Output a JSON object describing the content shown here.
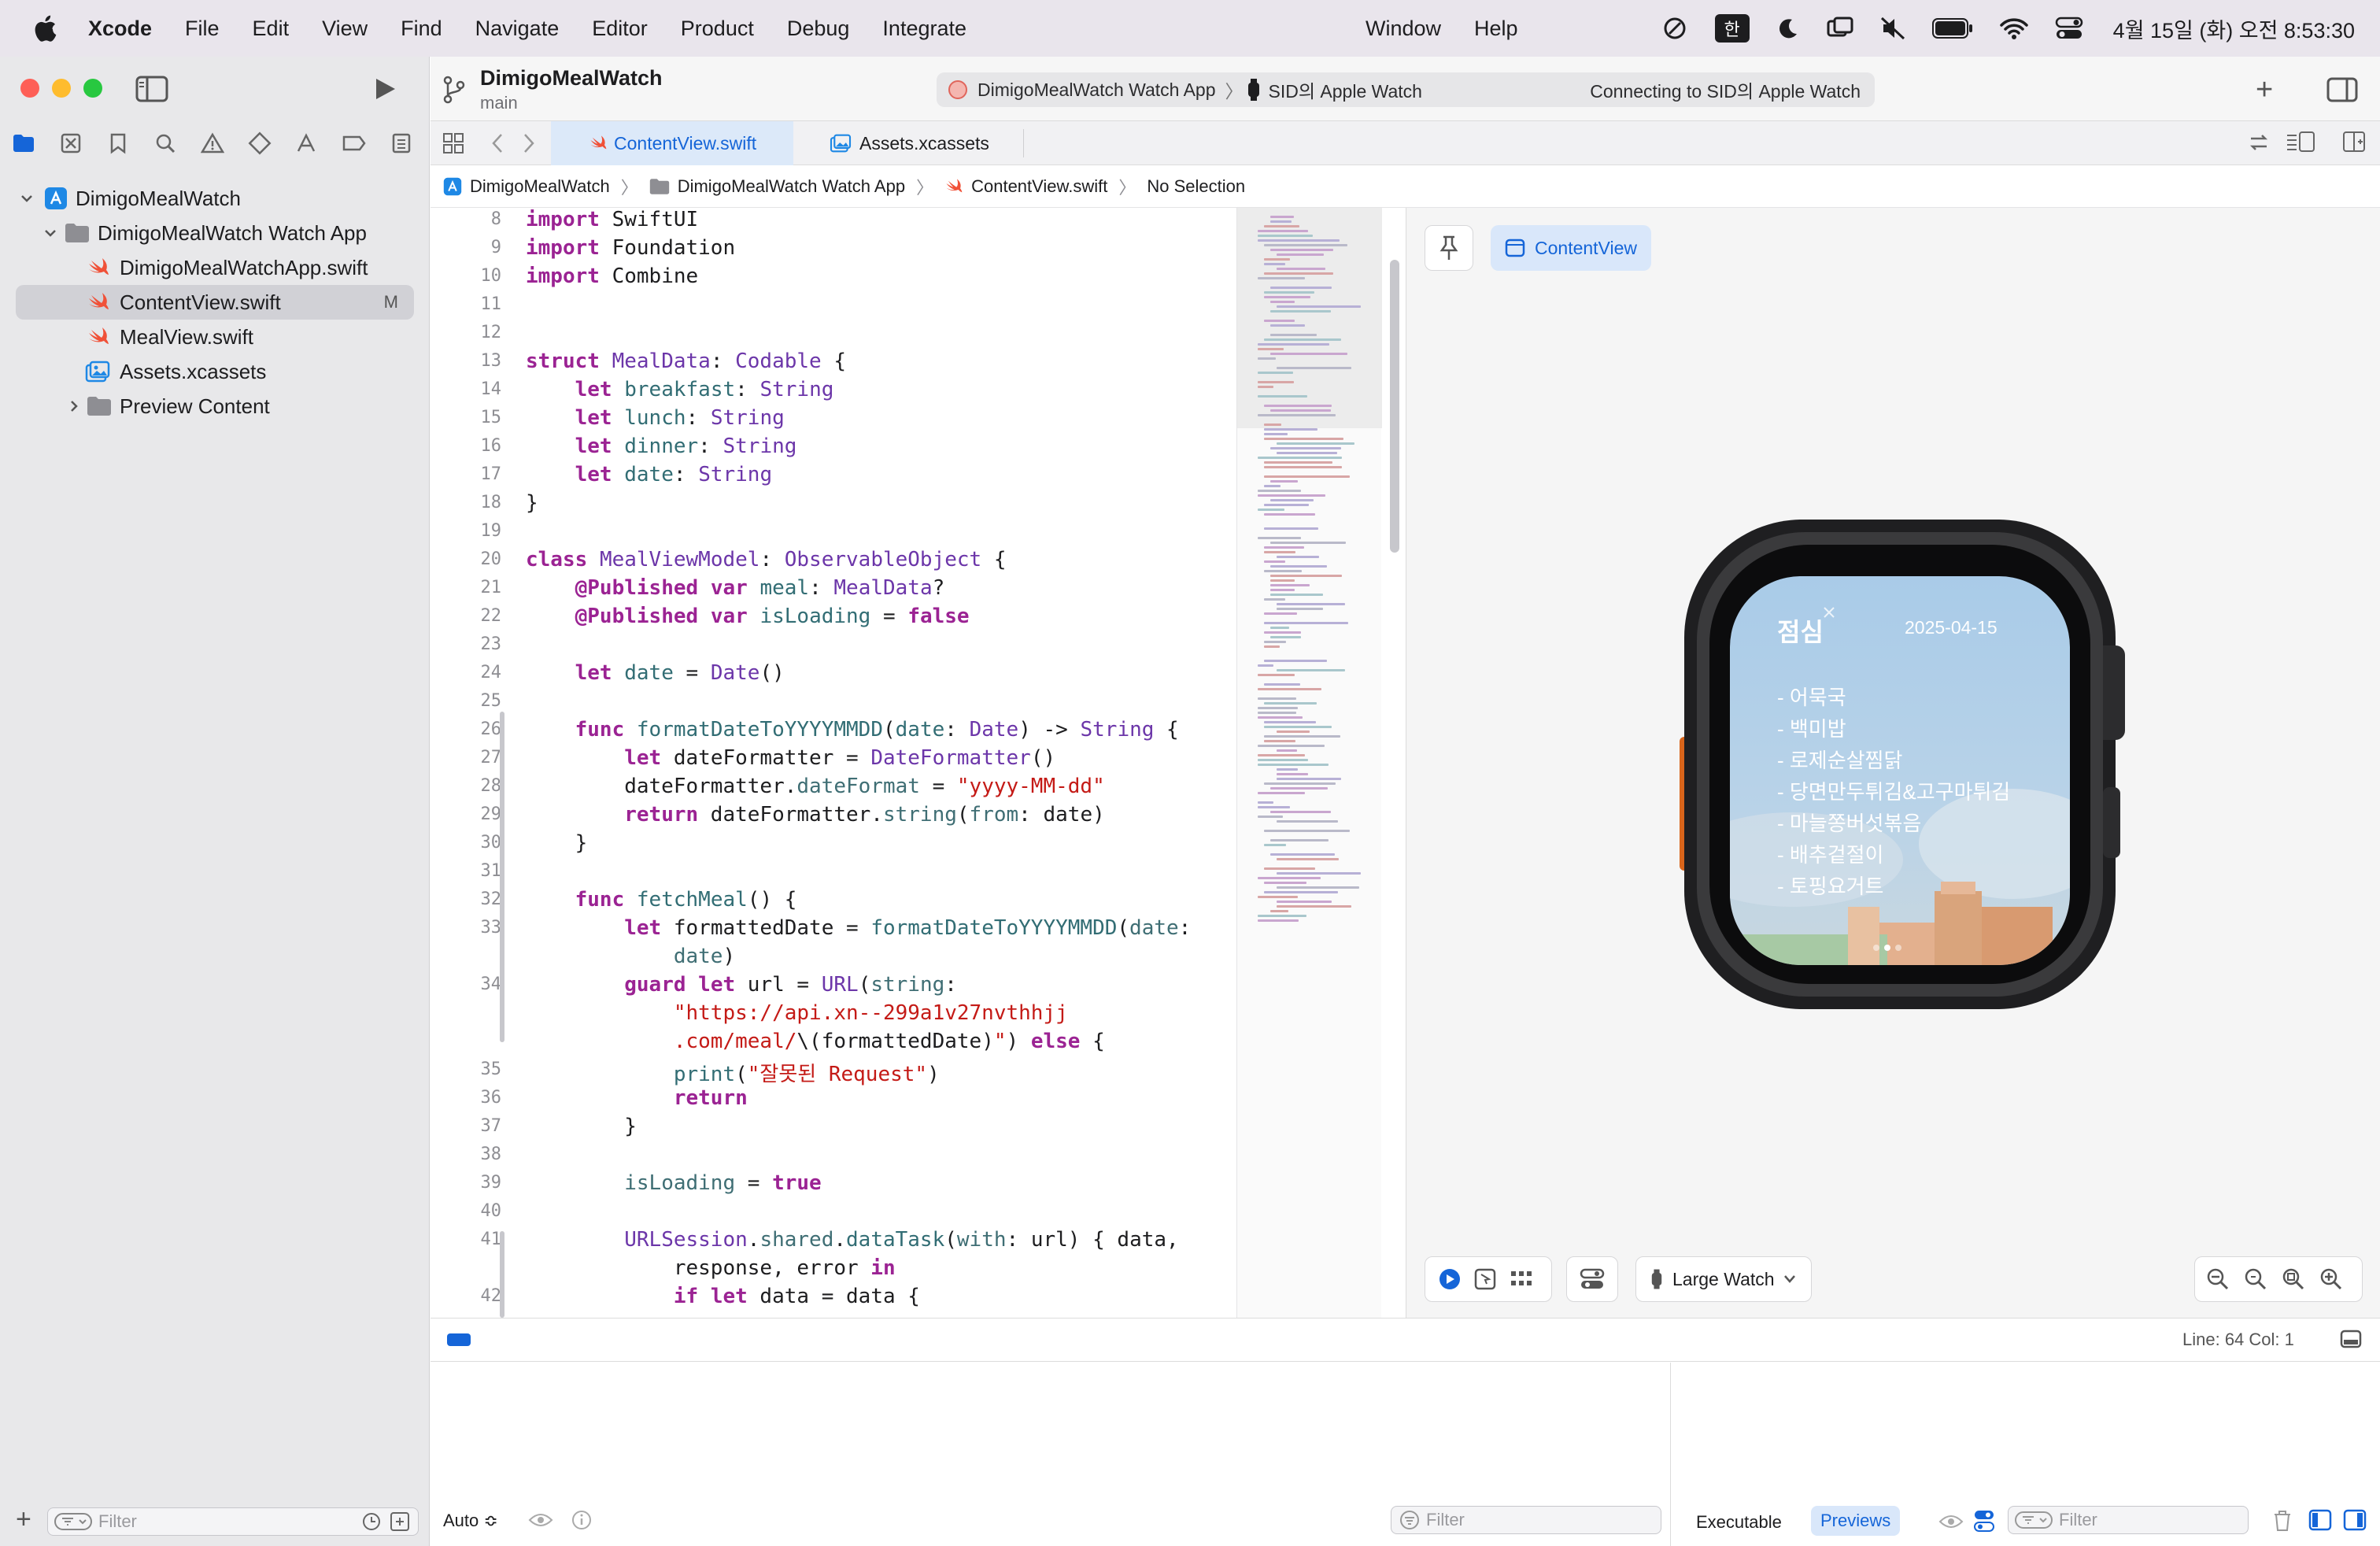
{
  "menubar": {
    "app_name": "Xcode",
    "menus": [
      "File",
      "Edit",
      "View",
      "Find",
      "Navigate",
      "Editor",
      "Product",
      "Debug",
      "Integrate"
    ],
    "right_menus": [
      "Window",
      "Help"
    ],
    "ime_label": "한",
    "clock": "4월 15일 (화) 오전 8:53:30"
  },
  "toolbar": {
    "project_title": "DimigoMealWatch",
    "branch": "main",
    "scheme_target": "DimigoMealWatch Watch App",
    "scheme_device": "SID의 Apple Watch",
    "status": "Connecting to SID의 Apple Watch",
    "add_label": "+"
  },
  "navigator": {
    "items": [
      {
        "label": "DimigoMealWatch",
        "badge": ""
      },
      {
        "label": "DimigoMealWatch Watch App",
        "badge": ""
      },
      {
        "label": "DimigoMealWatchApp.swift",
        "badge": ""
      },
      {
        "label": "ContentView.swift",
        "badge": "M"
      },
      {
        "label": "MealView.swift",
        "badge": ""
      },
      {
        "label": "Assets.xcassets",
        "badge": ""
      },
      {
        "label": "Preview Content",
        "badge": ""
      }
    ],
    "filter_placeholder": "Filter",
    "add_label": "+"
  },
  "tabs": [
    {
      "label": "ContentView.swift",
      "active": true
    },
    {
      "label": "Assets.xcassets",
      "active": false
    }
  ],
  "jumpbar": [
    "DimigoMealWatch",
    "DimigoMealWatch Watch App",
    "ContentView.swift",
    "No Selection"
  ],
  "code": {
    "line_numbers": [
      "8",
      "9",
      "10",
      "11",
      "12",
      "13",
      "14",
      "15",
      "16",
      "17",
      "18",
      "19",
      "20",
      "21",
      "22",
      "23",
      "24",
      "25",
      "26",
      "27",
      "28",
      "29",
      "30",
      "31",
      "32",
      "33",
      "",
      "34",
      "",
      "",
      "35",
      "36",
      "37",
      "38",
      "39",
      "40",
      "41",
      "",
      "42"
    ]
  },
  "canvas": {
    "preview_label": "ContentView",
    "device_label": "Large Watch"
  },
  "watch": {
    "title": "점심",
    "date": "2025-04-15",
    "items": [
      "- 어묵국",
      "- 백미밥",
      "- 로제순살찜닭",
      "- 당면만두튀김&고구마튀김",
      "- 마늘쫑버섯볶음",
      "- 배추겉절이",
      "- 토핑요거트"
    ]
  },
  "debug": {
    "line_col": "Line: 64  Col: 1",
    "auto_label": "Auto ≎",
    "filter_placeholder": "Filter",
    "executable_label": "Executable",
    "previews_label": "Previews",
    "filter2_placeholder": "Filter"
  },
  "colors": {
    "accent": "#1565d8",
    "keyword": "#9b2393",
    "string": "#c41a16",
    "type": "#6c36a9",
    "swift_orange": "#f05138",
    "folder_gray": "#8e8e93"
  }
}
